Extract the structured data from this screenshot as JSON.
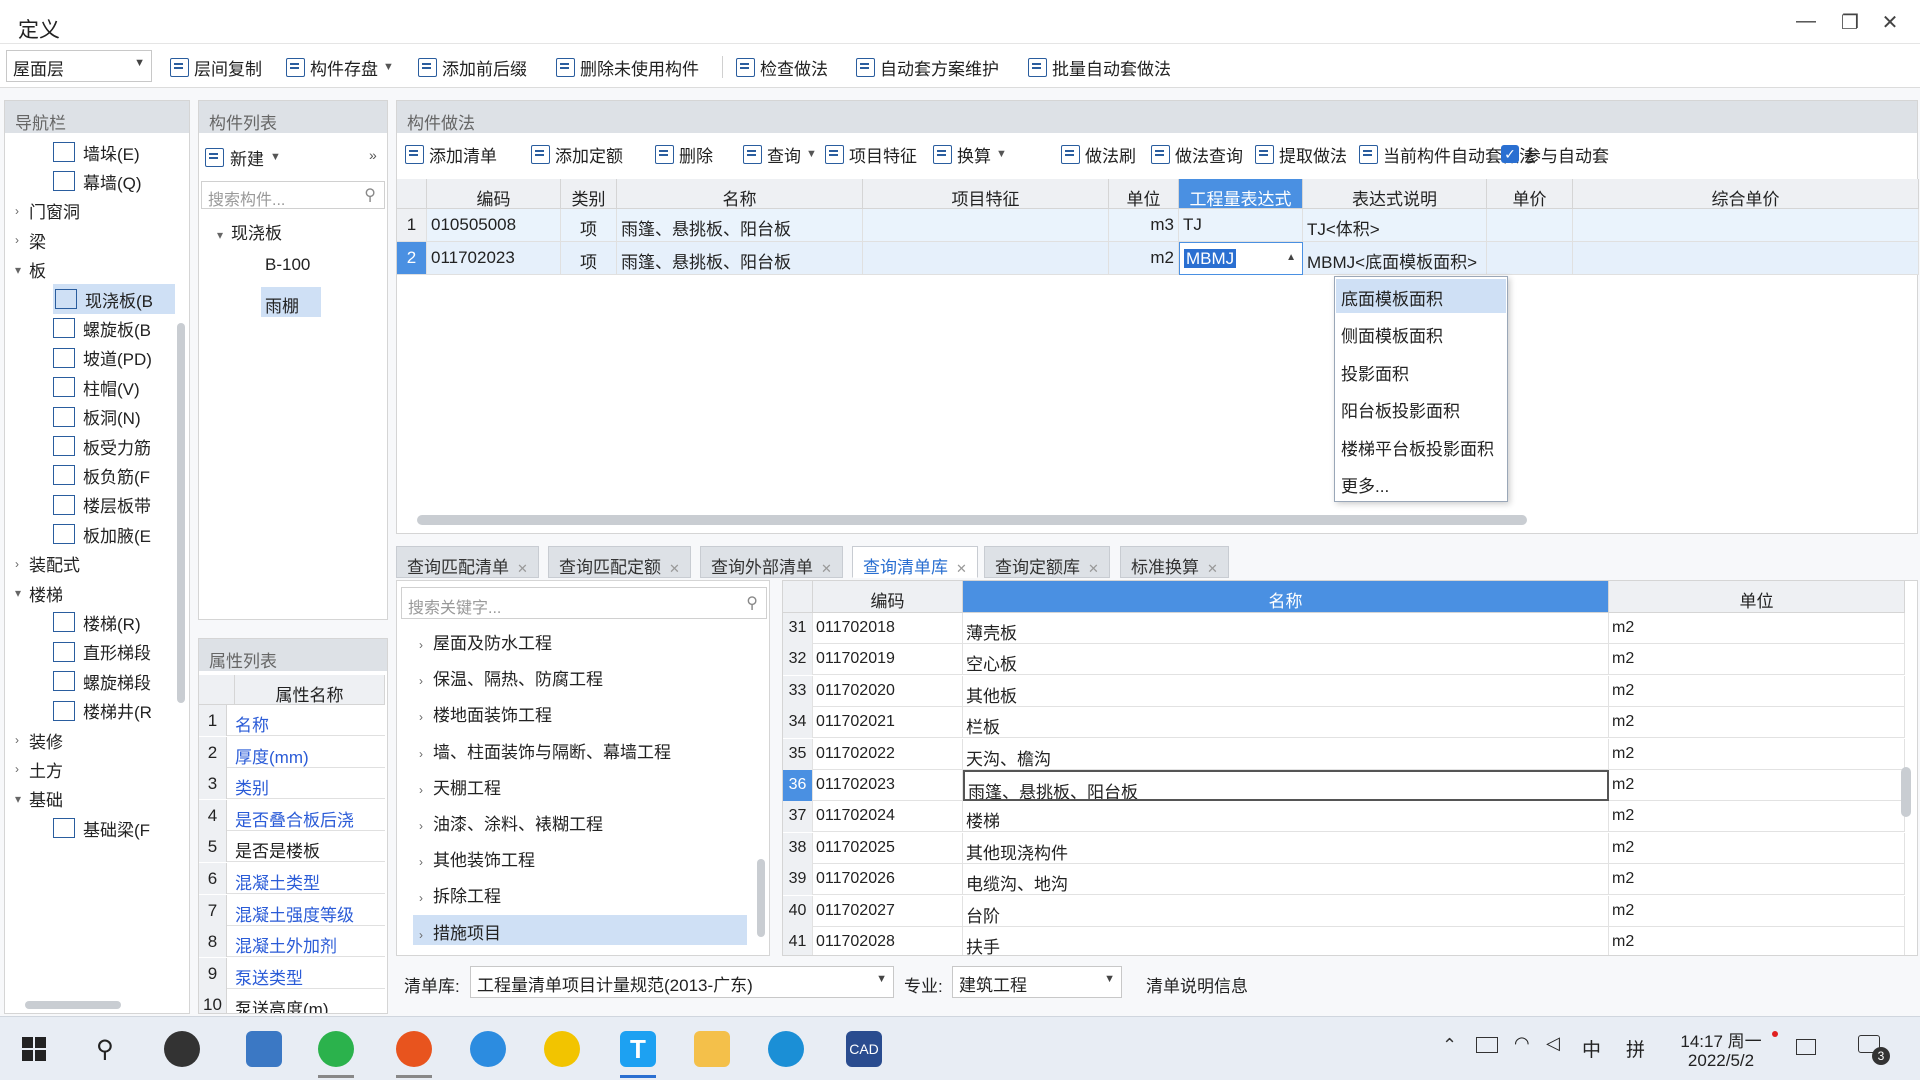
{
  "window": {
    "title": "定义"
  },
  "toolbar": {
    "floor": "屋面层",
    "items": [
      "层间复制",
      "构件存盘",
      "添加前后缀",
      "删除未使用构件",
      "检查做法",
      "自动套方案维护",
      "批量自动套做法"
    ]
  },
  "nav": {
    "header": "导航栏",
    "items": [
      {
        "label": "墙垛(E)",
        "type": "child"
      },
      {
        "label": "幕墙(Q)",
        "type": "child"
      },
      {
        "label": "门窗洞",
        "type": "group",
        "open": false
      },
      {
        "label": "梁",
        "type": "group",
        "open": false
      },
      {
        "label": "板",
        "type": "group",
        "open": true
      },
      {
        "label": "现浇板(B",
        "type": "child",
        "selected": true
      },
      {
        "label": "螺旋板(B",
        "type": "child"
      },
      {
        "label": "坡道(PD)",
        "type": "child"
      },
      {
        "label": "柱帽(V)",
        "type": "child"
      },
      {
        "label": "板洞(N)",
        "type": "child"
      },
      {
        "label": "板受力筋",
        "type": "child"
      },
      {
        "label": "板负筋(F",
        "type": "child"
      },
      {
        "label": "楼层板带",
        "type": "child"
      },
      {
        "label": "板加腋(E",
        "type": "child"
      },
      {
        "label": "装配式",
        "type": "group",
        "open": false
      },
      {
        "label": "楼梯",
        "type": "group",
        "open": true
      },
      {
        "label": "楼梯(R)",
        "type": "child"
      },
      {
        "label": "直形梯段",
        "type": "child"
      },
      {
        "label": "螺旋梯段",
        "type": "child"
      },
      {
        "label": "楼梯井(R",
        "type": "child"
      },
      {
        "label": "装修",
        "type": "group",
        "open": false
      },
      {
        "label": "土方",
        "type": "group",
        "open": false
      },
      {
        "label": "基础",
        "type": "group",
        "open": true
      },
      {
        "label": "基础梁(F",
        "type": "child"
      }
    ]
  },
  "components": {
    "header": "构件列表",
    "new_label": "新建",
    "search_placeholder": "搜索构件...",
    "tree_root": "现浇板",
    "items": [
      "B-100",
      "雨棚"
    ]
  },
  "properties": {
    "header": "属性列表",
    "col_name": "属性名称",
    "rows": [
      {
        "n": "1",
        "name": "名称",
        "blue": true
      },
      {
        "n": "2",
        "name": "厚度(mm)",
        "blue": true
      },
      {
        "n": "3",
        "name": "类别",
        "blue": true
      },
      {
        "n": "4",
        "name": "是否叠合板后浇",
        "blue": true
      },
      {
        "n": "5",
        "name": "是否是楼板",
        "blue": false
      },
      {
        "n": "6",
        "name": "混凝土类型",
        "blue": true
      },
      {
        "n": "7",
        "name": "混凝土强度等级",
        "blue": true
      },
      {
        "n": "8",
        "name": "混凝土外加剂",
        "blue": true
      },
      {
        "n": "9",
        "name": "泵送类型",
        "blue": true
      },
      {
        "n": "10",
        "name": "泵送高度(m)",
        "blue": false
      }
    ]
  },
  "method": {
    "header": "构件做法",
    "toolbar": [
      "添加清单",
      "添加定额",
      "删除",
      "查询",
      "项目特征",
      "换算",
      "做法刷",
      "做法查询",
      "提取做法",
      "当前构件自动套做法",
      "参与自动套"
    ],
    "columns": [
      "编码",
      "类别",
      "名称",
      "项目特征",
      "单位",
      "工程量表达式",
      "表达式说明",
      "单价",
      "综合单价"
    ],
    "rows": [
      {
        "n": "1",
        "code": "010505008",
        "cat": "项",
        "name": "雨篷、悬挑板、阳台板",
        "feature": "",
        "unit": "m3",
        "expr": "TJ",
        "desc": "TJ<体积>"
      },
      {
        "n": "2",
        "code": "011702023",
        "cat": "项",
        "name": "雨篷、悬挑板、阳台板",
        "feature": "",
        "unit": "m2",
        "expr": "MBMJ",
        "desc": "MBMJ<底面模板面积>"
      }
    ],
    "dropdown": [
      "底面模板面积",
      "侧面模板面积",
      "投影面积",
      "阳台板投影面积",
      "楼梯平台板投影面积",
      "更多..."
    ]
  },
  "bottom": {
    "tabs": [
      "查询匹配清单",
      "查询匹配定额",
      "查询外部清单",
      "查询清单库",
      "查询定额库",
      "标准换算"
    ],
    "search_placeholder": "搜索关键字...",
    "tree": [
      "屋面及防水工程",
      "保温、隔热、防腐工程",
      "楼地面装饰工程",
      "墙、柱面装饰与隔断、幕墙工程",
      "天棚工程",
      "油漆、涂料、裱糊工程",
      "其他装饰工程",
      "拆除工程",
      "措施项目"
    ],
    "columns": [
      "编码",
      "名称",
      "单位"
    ],
    "rows": [
      {
        "n": "31",
        "code": "011702018",
        "name": "薄壳板",
        "unit": "m2"
      },
      {
        "n": "32",
        "code": "011702019",
        "name": "空心板",
        "unit": "m2"
      },
      {
        "n": "33",
        "code": "011702020",
        "name": "其他板",
        "unit": "m2"
      },
      {
        "n": "34",
        "code": "011702021",
        "name": "栏板",
        "unit": "m2"
      },
      {
        "n": "35",
        "code": "011702022",
        "name": "天沟、檐沟",
        "unit": "m2"
      },
      {
        "n": "36",
        "code": "011702023",
        "name": "雨篷、悬挑板、阳台板",
        "unit": "m2"
      },
      {
        "n": "37",
        "code": "011702024",
        "name": "楼梯",
        "unit": "m2"
      },
      {
        "n": "38",
        "code": "011702025",
        "name": "其他现浇构件",
        "unit": "m2"
      },
      {
        "n": "39",
        "code": "011702026",
        "name": "电缆沟、地沟",
        "unit": "m2"
      },
      {
        "n": "40",
        "code": "011702027",
        "name": "台阶",
        "unit": "m2"
      },
      {
        "n": "41",
        "code": "011702028",
        "name": "扶手",
        "unit": "m2"
      }
    ],
    "lib_label": "清单库:",
    "lib_value": "工程量清单项目计量规范(2013-广东)",
    "major_label": "专业:",
    "major_value": "建筑工程",
    "info": "清单说明信息"
  },
  "taskbar": {
    "time": "14:17 周一",
    "date": "2022/5/2",
    "ime1": "中",
    "ime2": "拼",
    "notif": "3"
  }
}
